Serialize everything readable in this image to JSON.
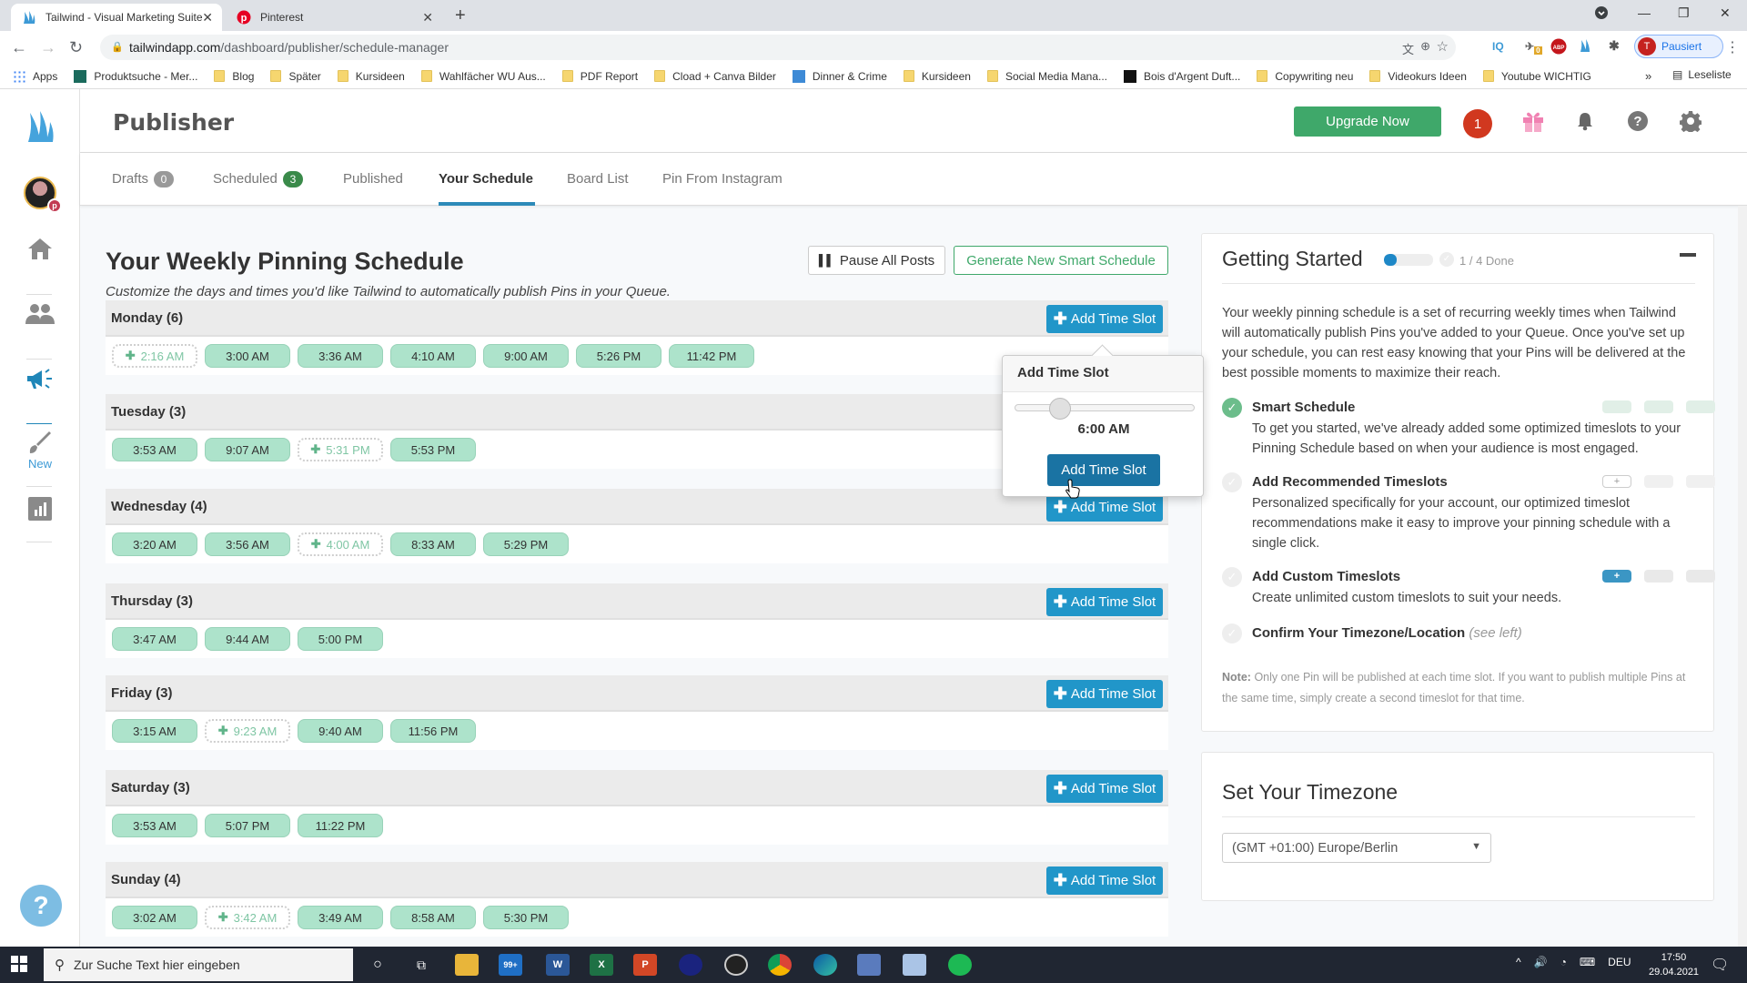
{
  "browser": {
    "tabs": [
      {
        "title": "Tailwind - Visual Marketing Suite",
        "active": true
      },
      {
        "title": "Pinterest",
        "active": false
      }
    ],
    "url_domain": "tailwindapp.com",
    "url_path": "/dashboard/publisher/schedule-manager",
    "profile_initial": "T",
    "profile_label": "Pausiert",
    "bookmarks": [
      {
        "label": "Apps",
        "icon": "apps-grid-icon"
      },
      {
        "label": "Produktsuche - Mer...",
        "icon": "shirt-icon"
      },
      {
        "label": "Blog",
        "icon": "folder-icon"
      },
      {
        "label": "Später",
        "icon": "folder-icon"
      },
      {
        "label": "Kursideen",
        "icon": "folder-icon"
      },
      {
        "label": "Wahlfächer WU Aus...",
        "icon": "folder-icon"
      },
      {
        "label": "PDF Report",
        "icon": "folder-icon"
      },
      {
        "label": "Cload + Canva Bilder",
        "icon": "folder-icon"
      },
      {
        "label": "Dinner & Crime",
        "icon": "jd-icon"
      },
      {
        "label": "Kursideen",
        "icon": "folder-icon"
      },
      {
        "label": "Social Media Mana...",
        "icon": "folder-icon"
      },
      {
        "label": "Bois d'Argent Duft...",
        "icon": "bois-icon"
      },
      {
        "label": "Copywriting neu",
        "icon": "folder-icon"
      },
      {
        "label": "Videokurs Ideen",
        "icon": "folder-icon"
      },
      {
        "label": "Youtube WICHTIG",
        "icon": "folder-icon"
      }
    ],
    "bookmarks_more": "»",
    "reading_list": "Leseliste",
    "extensions": [
      "translate-icon",
      "zoom-icon",
      "star-icon",
      "iq-icon",
      "bird-icon",
      "adblock-icon",
      "tailwind-icon",
      "puzzle-icon"
    ],
    "ext_badge": "0"
  },
  "sidebar": {
    "items": [
      {
        "name": "home",
        "icon": "home-icon"
      },
      {
        "name": "audience",
        "icon": "users-icon"
      },
      {
        "name": "publisher",
        "icon": "megaphone-icon",
        "active": true
      },
      {
        "name": "create",
        "icon": "brush-icon",
        "label": "New"
      },
      {
        "name": "insights",
        "icon": "chart-icon"
      }
    ]
  },
  "header": {
    "title": "Publisher",
    "upgrade_label": "Upgrade Now",
    "notification_count": "1"
  },
  "subnav": {
    "tabs": [
      {
        "label": "Drafts",
        "badge": "0"
      },
      {
        "label": "Scheduled",
        "badge": "3"
      },
      {
        "label": "Published"
      },
      {
        "label": "Your Schedule",
        "active": true
      },
      {
        "label": "Board List"
      },
      {
        "label": "Pin From Instagram"
      }
    ]
  },
  "schedule": {
    "title": "Your Weekly Pinning Schedule",
    "subtitle": "Customize the days and times you'd like Tailwind to automatically publish Pins in your Queue.",
    "pause_label": "Pause All Posts",
    "generate_label": "Generate New Smart Schedule",
    "add_slot_label": "Add Time Slot",
    "days": [
      {
        "label": "Monday (6)",
        "slots": [
          {
            "time": "2:16 AM",
            "suggested": true
          },
          {
            "time": "3:00 AM"
          },
          {
            "time": "3:36 AM"
          },
          {
            "time": "4:10 AM"
          },
          {
            "time": "9:00 AM"
          },
          {
            "time": "5:26 PM"
          },
          {
            "time": "11:42 PM"
          }
        ]
      },
      {
        "label": "Tuesday (3)",
        "slots": [
          {
            "time": "3:53 AM"
          },
          {
            "time": "9:07 AM"
          },
          {
            "time": "5:31 PM",
            "suggested": true
          },
          {
            "time": "5:53 PM"
          }
        ]
      },
      {
        "label": "Wednesday (4)",
        "slots": [
          {
            "time": "3:20 AM"
          },
          {
            "time": "3:56 AM"
          },
          {
            "time": "4:00 AM",
            "suggested": true
          },
          {
            "time": "8:33 AM"
          },
          {
            "time": "5:29 PM"
          }
        ]
      },
      {
        "label": "Thursday (3)",
        "slots": [
          {
            "time": "3:47 AM"
          },
          {
            "time": "9:44 AM"
          },
          {
            "time": "5:00 PM"
          }
        ]
      },
      {
        "label": "Friday (3)",
        "slots": [
          {
            "time": "3:15 AM"
          },
          {
            "time": "9:23 AM",
            "suggested": true
          },
          {
            "time": "9:40 AM"
          },
          {
            "time": "11:56 PM"
          }
        ]
      },
      {
        "label": "Saturday (3)",
        "slots": [
          {
            "time": "3:53 AM"
          },
          {
            "time": "5:07 PM"
          },
          {
            "time": "11:22 PM"
          }
        ]
      },
      {
        "label": "Sunday (4)",
        "slots": [
          {
            "time": "3:02 AM"
          },
          {
            "time": "3:42 AM",
            "suggested": true
          },
          {
            "time": "3:49 AM"
          },
          {
            "time": "8:58 AM"
          },
          {
            "time": "5:30 PM"
          }
        ]
      }
    ]
  },
  "popover": {
    "title": "Add Time Slot",
    "time": "6:00 AM",
    "slider_fraction": 0.25,
    "button_label": "Add Time Slot"
  },
  "getting_started": {
    "title": "Getting Started",
    "progress_fraction": 0.25,
    "done_label": "1 / 4 Done",
    "intro": "Your weekly pinning schedule is a set of recurring weekly times when Tailwind will automatically publish Pins you've added to your Queue. Once you've set up your schedule, you can rest easy knowing that your Pins will be delivered at the best possible moments to maximize their reach.",
    "steps": [
      {
        "title": "Smart Schedule",
        "desc": "To get you started, we've already added some optimized timeslots to your Pinning Schedule based on when your audience is most engaged.",
        "done": true
      },
      {
        "title": "Add Recommended Timeslots",
        "desc": "Personalized specifically for your account, our optimized timeslot recommendations make it easy to improve your pinning schedule with a single click.",
        "done": false
      },
      {
        "title": "Add Custom Timeslots",
        "desc": "Create unlimited custom timeslots to suit your needs.",
        "done": false
      },
      {
        "title": "Confirm Your Timezone/Location",
        "hint": "(see left)",
        "done": false
      }
    ],
    "note_label": "Note:",
    "note": "Only one Pin will be published at each time slot. If you want to publish multiple Pins at the same time, simply create a second timeslot for that time."
  },
  "timezone": {
    "title": "Set Your Timezone",
    "selected": "(GMT +01:00) Europe/Berlin"
  },
  "taskbar": {
    "search_placeholder": "Zur Suche Text hier eingeben",
    "mail_badge": "99+",
    "language": "DEU",
    "time": "17:50",
    "date": "29.04.2021"
  },
  "colors": {
    "brand_blue": "#2196c9",
    "upgrade_green": "#3fa86a",
    "slot_green": "#ade3cb",
    "notif_red": "#d1381f"
  }
}
